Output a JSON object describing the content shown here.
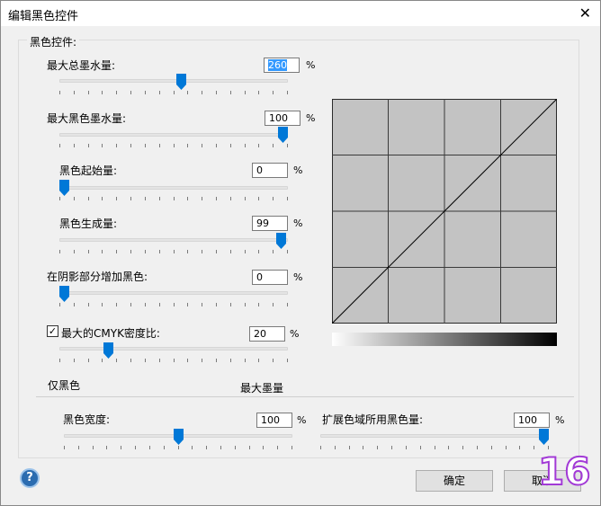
{
  "window": {
    "title": "编辑黑色控件",
    "close_label": "✕"
  },
  "group": {
    "legend": "黑色控件:"
  },
  "controls": [
    {
      "label": "最大总墨水量:",
      "value": "260",
      "unit": "%",
      "selected": true
    },
    {
      "label": "最大黑色墨水量:",
      "value": "100",
      "unit": "%"
    },
    {
      "label": "黑色起始量:",
      "value": "0",
      "unit": "%"
    },
    {
      "label": "黑色生成量:",
      "value": "99",
      "unit": "%"
    },
    {
      "label": "在阴影部分增加黑色:",
      "value": "0",
      "unit": "%"
    },
    {
      "label": "最大的CMYK密度比:",
      "value": "20",
      "unit": "%",
      "checked": true
    }
  ],
  "bottom": {
    "left_caption": "仅黑色",
    "right_caption": "最大墨量",
    "width_label": "黑色宽度:",
    "width_value": "100",
    "width_unit": "%",
    "gamut_label": "扩展色域所用黑色量:",
    "gamut_value": "100",
    "gamut_unit": "%"
  },
  "buttons": {
    "ok": "确定",
    "cancel": "取消"
  },
  "help_glyph": "?",
  "badge": "16",
  "accent_color": "#0078d7",
  "graph_line": "linear diagonal",
  "slider_levels": {
    "max_total_ink": 0.53,
    "max_black_ink": 1.0,
    "black_start": 0.0,
    "black_generation": 0.99,
    "shadow_black": 0.0,
    "cmyk_density": 0.2,
    "black_width": 0.5,
    "gamut_black": 1.0
  }
}
